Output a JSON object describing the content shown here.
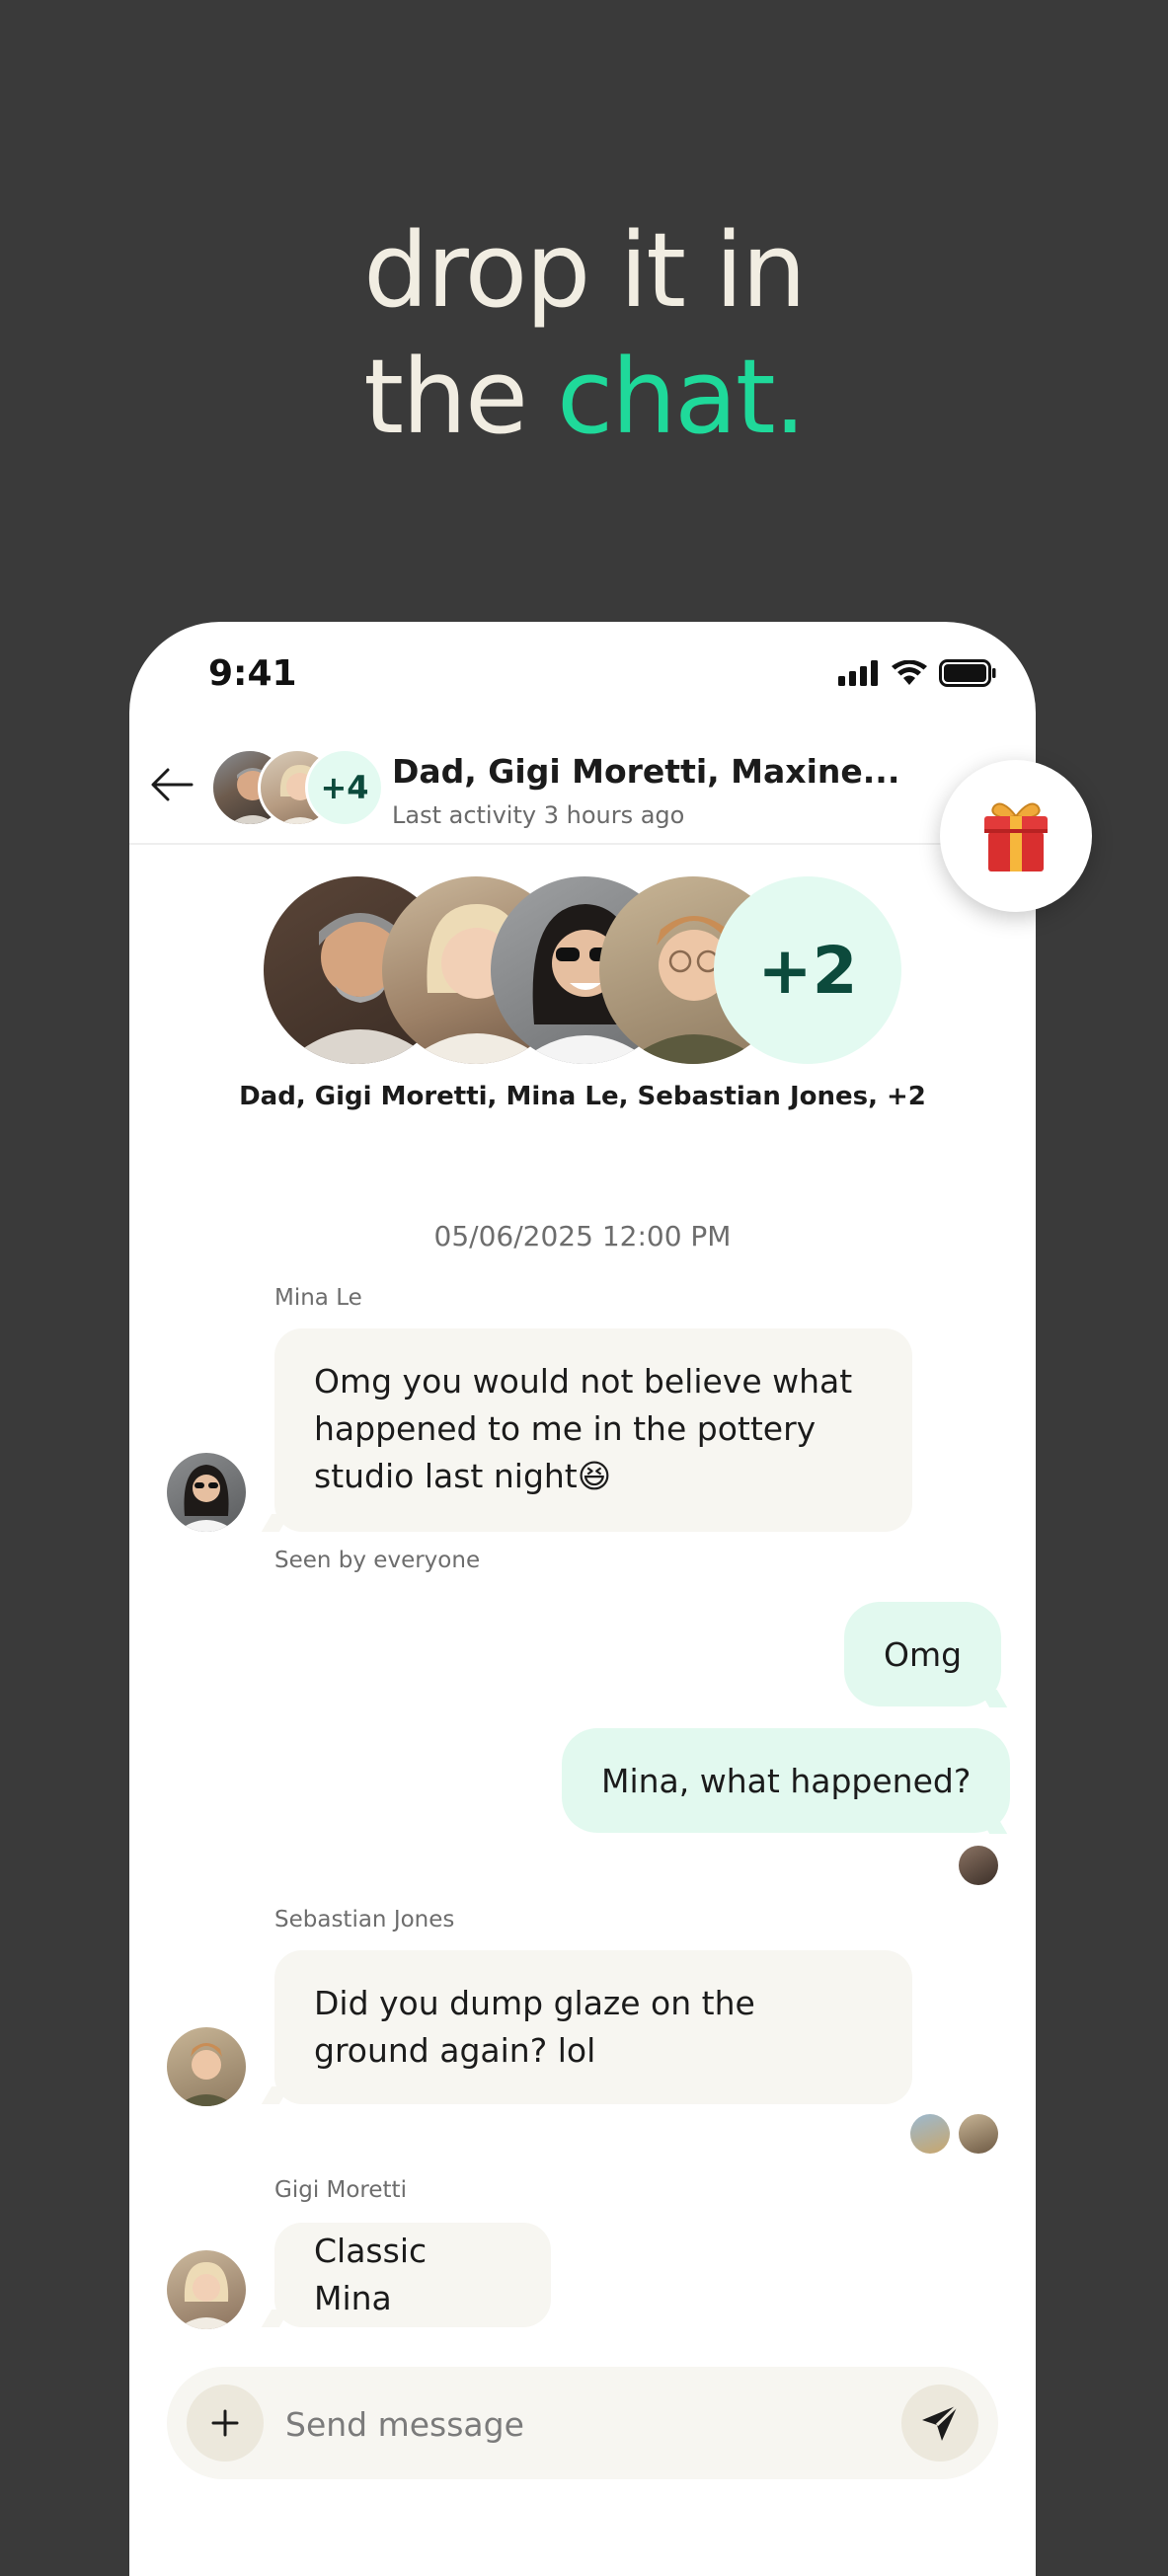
{
  "headline": {
    "line1": "drop it in",
    "line2_prefix": "the ",
    "line2_accent": "chat."
  },
  "colors": {
    "background": "#3a3a3a",
    "headline_text": "#f1ede2",
    "accent_green": "#1fd99a",
    "incoming_bubble": "#f7f6f1",
    "outgoing_bubble": "#e2f9ef",
    "plus_badge_bg": "#e3faf1",
    "plus_badge_text": "#0c4a3c"
  },
  "status_bar": {
    "time": "9:41",
    "icons": [
      "cellular-signal-icon",
      "wifi-icon",
      "battery-icon"
    ]
  },
  "header": {
    "back_icon": "arrow-left-icon",
    "avatar_extra_count": "+4",
    "title": "Dad, Gigi Moretti, Maxine...",
    "subtitle": "Last activity 3 hours ago"
  },
  "gift_button": {
    "icon": "gift-icon"
  },
  "group_intro": {
    "extra_count": "+2",
    "names": "Dad, Gigi Moretti, Mina Le, Sebastian Jones, +2"
  },
  "conversation": {
    "timestamp": "05/06/2025 12:00 PM",
    "messages": [
      {
        "sender": "Mina Le",
        "text": "Omg you would not believe what happened to me in the pottery studio last night",
        "emoji": "😆",
        "direction": "incoming"
      },
      {
        "text": "Omg",
        "direction": "outgoing"
      },
      {
        "text": "Mina, what happened?",
        "direction": "outgoing"
      },
      {
        "sender": "Sebastian Jones",
        "text": "Did you dump glaze on the ground again? lol",
        "direction": "incoming"
      },
      {
        "sender": "Gigi Moretti",
        "text": "Classic Mina",
        "direction": "incoming"
      }
    ],
    "seen_label": "Seen by everyone"
  },
  "composer": {
    "placeholder": "Send message",
    "add_icon": "plus-icon",
    "send_icon": "send-icon"
  }
}
